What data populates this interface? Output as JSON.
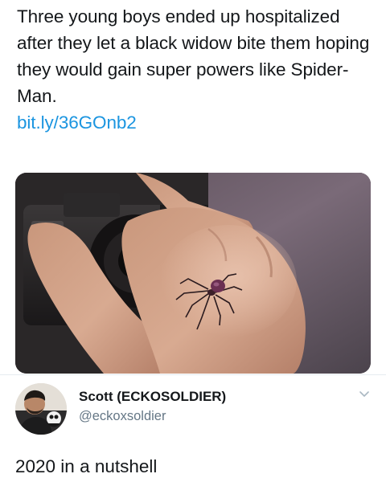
{
  "post": {
    "text": "Three young boys ended up hospitalized after they let a black widow bite them hoping they would gain super powers like Spider-Man.",
    "link": "bit.ly/36GOnb2",
    "colors": {
      "link": "#1b95e0",
      "text": "#14171a"
    }
  },
  "author": {
    "name": "Scott (ECKOSOLDIER)",
    "handle": "@eckoxsoldier",
    "menu_icon": "chevron-down-icon",
    "handle_color": "#657786"
  },
  "reply": {
    "text": "2020 in a nutshell"
  }
}
